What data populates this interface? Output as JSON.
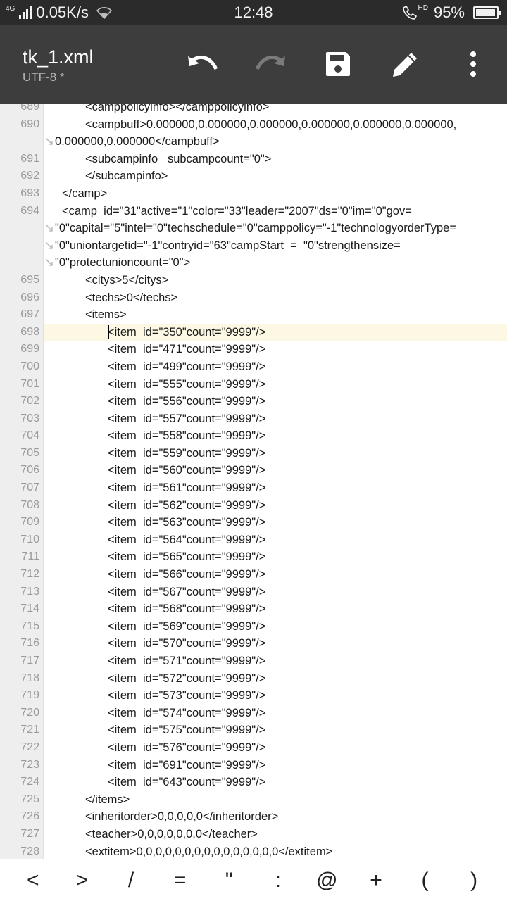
{
  "status_bar": {
    "network": "4G",
    "speed": "0.05K/s",
    "time": "12:48",
    "hd": "HD",
    "battery": "95%",
    "battery_level": 0.95
  },
  "app_bar": {
    "title": "tk_1.xml",
    "encoding": "UTF-8 *",
    "actions": {
      "undo_icon": "undo-icon",
      "redo_icon": "redo-icon",
      "save_icon": "save-icon",
      "edit_icon": "pencil-icon",
      "more_icon": "more-vert-icon"
    }
  },
  "editor": {
    "current_line": "698",
    "lines": [
      {
        "n": "689",
        "indent": 4,
        "segs": [
          "<camppolicyinfo></camppolicyinfo>"
        ]
      },
      {
        "n": "690",
        "indent": 4,
        "segs": [
          "<campbuff>0.000000,0.000000,0.000000,0.000000,0.000000,0.000000,",
          "0.000000,0.000000</campbuff>"
        ]
      },
      {
        "n": "691",
        "indent": 4,
        "segs": [
          "<subcampinfo   subcampcount=\"0\">"
        ]
      },
      {
        "n": "692",
        "indent": 4,
        "segs": [
          "</subcampinfo>"
        ]
      },
      {
        "n": "693",
        "indent": 2,
        "segs": [
          "</camp>"
        ]
      },
      {
        "n": "694",
        "indent": 2,
        "segs": [
          "<camp  id=\"31\"active=\"1\"color=\"33\"leader=\"2007\"ds=\"0\"im=\"0\"gov=",
          "\"0\"capital=\"5\"intel=\"0\"techschedule=\"0\"camppolicy=\"-1\"technologyorderType=",
          "\"0\"uniontargetid=\"-1\"contryid=\"63\"campStart  =  \"0\"strengthensize=",
          "\"0\"protectunioncount=\"0\">"
        ]
      },
      {
        "n": "695",
        "indent": 4,
        "segs": [
          "<citys>5</citys>"
        ]
      },
      {
        "n": "696",
        "indent": 4,
        "segs": [
          "<techs>0</techs>"
        ]
      },
      {
        "n": "697",
        "indent": 4,
        "segs": [
          "<items>"
        ]
      },
      {
        "n": "698",
        "indent": 6,
        "segs": [
          "<item  id=\"350\"count=\"9999\"/>"
        ]
      },
      {
        "n": "699",
        "indent": 6,
        "segs": [
          "<item  id=\"471\"count=\"9999\"/>"
        ]
      },
      {
        "n": "700",
        "indent": 6,
        "segs": [
          "<item  id=\"499\"count=\"9999\"/>"
        ]
      },
      {
        "n": "701",
        "indent": 6,
        "segs": [
          "<item  id=\"555\"count=\"9999\"/>"
        ]
      },
      {
        "n": "702",
        "indent": 6,
        "segs": [
          "<item  id=\"556\"count=\"9999\"/>"
        ]
      },
      {
        "n": "703",
        "indent": 6,
        "segs": [
          "<item  id=\"557\"count=\"9999\"/>"
        ]
      },
      {
        "n": "704",
        "indent": 6,
        "segs": [
          "<item  id=\"558\"count=\"9999\"/>"
        ]
      },
      {
        "n": "705",
        "indent": 6,
        "segs": [
          "<item  id=\"559\"count=\"9999\"/>"
        ]
      },
      {
        "n": "706",
        "indent": 6,
        "segs": [
          "<item  id=\"560\"count=\"9999\"/>"
        ]
      },
      {
        "n": "707",
        "indent": 6,
        "segs": [
          "<item  id=\"561\"count=\"9999\"/>"
        ]
      },
      {
        "n": "708",
        "indent": 6,
        "segs": [
          "<item  id=\"562\"count=\"9999\"/>"
        ]
      },
      {
        "n": "709",
        "indent": 6,
        "segs": [
          "<item  id=\"563\"count=\"9999\"/>"
        ]
      },
      {
        "n": "710",
        "indent": 6,
        "segs": [
          "<item  id=\"564\"count=\"9999\"/>"
        ]
      },
      {
        "n": "711",
        "indent": 6,
        "segs": [
          "<item  id=\"565\"count=\"9999\"/>"
        ]
      },
      {
        "n": "712",
        "indent": 6,
        "segs": [
          "<item  id=\"566\"count=\"9999\"/>"
        ]
      },
      {
        "n": "713",
        "indent": 6,
        "segs": [
          "<item  id=\"567\"count=\"9999\"/>"
        ]
      },
      {
        "n": "714",
        "indent": 6,
        "segs": [
          "<item  id=\"568\"count=\"9999\"/>"
        ]
      },
      {
        "n": "715",
        "indent": 6,
        "segs": [
          "<item  id=\"569\"count=\"9999\"/>"
        ]
      },
      {
        "n": "716",
        "indent": 6,
        "segs": [
          "<item  id=\"570\"count=\"9999\"/>"
        ]
      },
      {
        "n": "717",
        "indent": 6,
        "segs": [
          "<item  id=\"571\"count=\"9999\"/>"
        ]
      },
      {
        "n": "718",
        "indent": 6,
        "segs": [
          "<item  id=\"572\"count=\"9999\"/>"
        ]
      },
      {
        "n": "719",
        "indent": 6,
        "segs": [
          "<item  id=\"573\"count=\"9999\"/>"
        ]
      },
      {
        "n": "720",
        "indent": 6,
        "segs": [
          "<item  id=\"574\"count=\"9999\"/>"
        ]
      },
      {
        "n": "721",
        "indent": 6,
        "segs": [
          "<item  id=\"575\"count=\"9999\"/>"
        ]
      },
      {
        "n": "722",
        "indent": 6,
        "segs": [
          "<item  id=\"576\"count=\"9999\"/>"
        ]
      },
      {
        "n": "723",
        "indent": 6,
        "segs": [
          "<item  id=\"691\"count=\"9999\"/>"
        ]
      },
      {
        "n": "724",
        "indent": 6,
        "segs": [
          "<item  id=\"643\"count=\"9999\"/>"
        ]
      },
      {
        "n": "725",
        "indent": 4,
        "segs": [
          "</items>"
        ]
      },
      {
        "n": "726",
        "indent": 4,
        "segs": [
          "<inheritorder>0,0,0,0,0</inheritorder>"
        ]
      },
      {
        "n": "727",
        "indent": 4,
        "segs": [
          "<teacher>0,0,0,0,0,0,0</teacher>"
        ]
      },
      {
        "n": "728",
        "indent": 4,
        "segs": [
          "<extitem>0,0,0,0,0,0,0,0,0,0,0,0,0,0,0</extitem>"
        ]
      }
    ]
  },
  "symbol_bar": {
    "keys": [
      "<",
      ">",
      "/",
      "=",
      "\"",
      ":",
      "@",
      "+",
      "(",
      ")"
    ]
  }
}
